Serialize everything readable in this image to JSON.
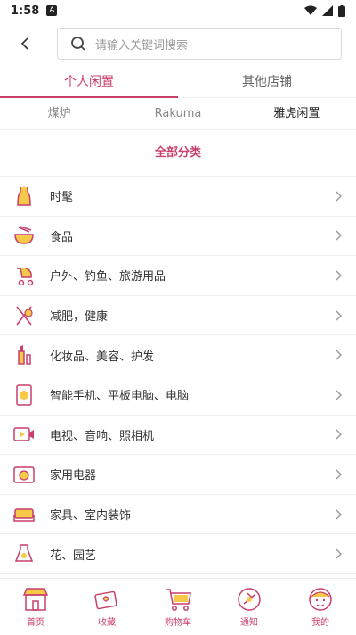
{
  "status": {
    "time": "1:58"
  },
  "search": {
    "placeholder": "请输入关键词搜索"
  },
  "tabs": [
    {
      "label": "个人闲置",
      "active": true
    },
    {
      "label": "其他店铺",
      "active": false
    }
  ],
  "subtabs": [
    {
      "label": "煤炉",
      "active": false
    },
    {
      "label": "Rakuma",
      "active": false
    },
    {
      "label": "雅虎闲置",
      "active": true
    }
  ],
  "all_categories_label": "全部分类",
  "categories": [
    {
      "label": "时髦",
      "icon": "dress-icon"
    },
    {
      "label": "食品",
      "icon": "food-bowl-icon"
    },
    {
      "label": "户外、钓鱼、旅游用品",
      "icon": "stroller-icon"
    },
    {
      "label": "减肥，健康",
      "icon": "dna-icon"
    },
    {
      "label": "化妆品、美容、护发",
      "icon": "cosmetics-icon"
    },
    {
      "label": "智能手机、平板电脑、电脑",
      "icon": "phone-icon"
    },
    {
      "label": "电视、音响、照相机",
      "icon": "video-camera-icon"
    },
    {
      "label": "家用电器",
      "icon": "appliance-icon"
    },
    {
      "label": "家具、室内装饰",
      "icon": "sofa-icon"
    },
    {
      "label": "花、园艺",
      "icon": "flower-pot-icon"
    }
  ],
  "nav": [
    {
      "label": "首页",
      "icon": "storefront-icon"
    },
    {
      "label": "收藏",
      "icon": "favorites-icon"
    },
    {
      "label": "购物车",
      "icon": "cart-icon"
    },
    {
      "label": "通知",
      "icon": "notification-icon"
    },
    {
      "label": "我的",
      "icon": "profile-icon"
    }
  ],
  "colors": {
    "accent": "#c83f6a",
    "icon_fill": "#f7c948"
  }
}
